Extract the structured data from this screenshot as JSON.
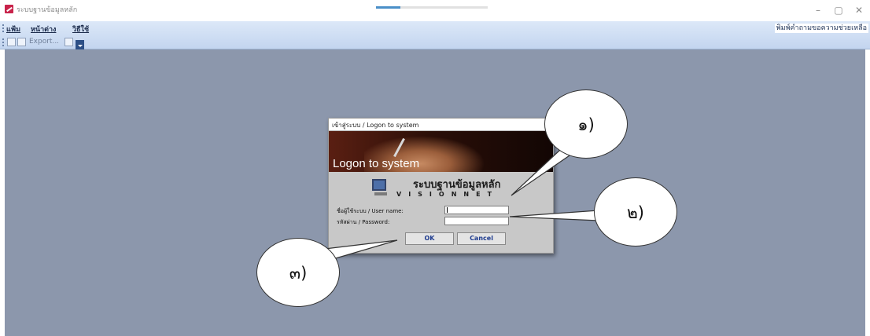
{
  "window": {
    "title": "ระบบฐานข้อมูลหลัก",
    "loading_progress": 0.22,
    "minimize_icon": "minimize-icon",
    "maximize_icon": "maximize-icon",
    "close_icon": "close-icon"
  },
  "menu": {
    "items": [
      "แฟ้ม",
      "หน้าต่าง",
      "วิธีใช้"
    ],
    "help_search": "พิมพ์คำถามขอความช่วยเหลือ"
  },
  "toolbar": {
    "export_label": "Export...",
    "icons": [
      "page-icon",
      "print-preview-icon",
      "printer-icon",
      "toolbar-options-icon"
    ]
  },
  "dialog": {
    "title": "เข้าสู่ระบบ / Logon to system",
    "banner_text": "Logon to system",
    "system_title": "ระบบฐานข้อมูลหลัก",
    "system_subtitle": "VISIONNET",
    "user_label": "ชื่อผู้ใช้ระบบ / User name:",
    "password_label": "รหัสผ่าน / Password:",
    "user_value": "",
    "password_value": "",
    "ok_label": "OK",
    "cancel_label": "Cancel"
  },
  "callouts": [
    "๑)",
    "๒)",
    "๓)"
  ],
  "colors": {
    "workspace": "#8c97ac",
    "menu_bar": "#c3d5ef",
    "dialog_bg": "#c8c8c8",
    "button_text": "#1f3c8f"
  }
}
